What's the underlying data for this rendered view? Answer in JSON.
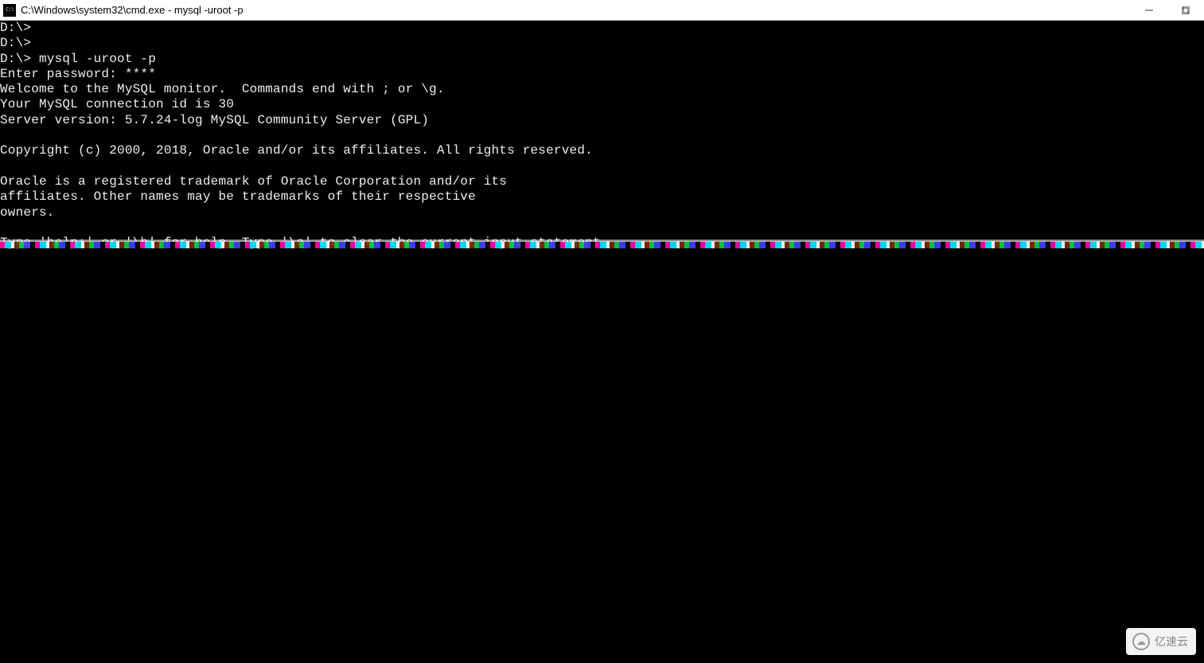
{
  "window": {
    "icon_glyph": "C:\\",
    "title": "C:\\Windows\\system32\\cmd.exe - mysql  -uroot -p"
  },
  "terminal": {
    "lines": [
      "D:\\>",
      "D:\\>",
      "D:\\> mysql -uroot -p",
      "Enter password: ****",
      "Welcome to the MySQL monitor.  Commands end with ; or \\g.",
      "Your MySQL connection id is 30",
      "Server version: 5.7.24-log MySQL Community Server (GPL)",
      "",
      "Copyright (c) 2000, 2018, Oracle and/or its affiliates. All rights reserved.",
      "",
      "Oracle is a registered trademark of Oracle Corporation and/or its",
      "affiliates. Other names may be trademarks of their respective",
      "owners.",
      "",
      "Type 'help;' or '\\h' for help. Type '\\c' to clear the current input statement."
    ]
  },
  "watermark": {
    "text": "亿速云"
  }
}
